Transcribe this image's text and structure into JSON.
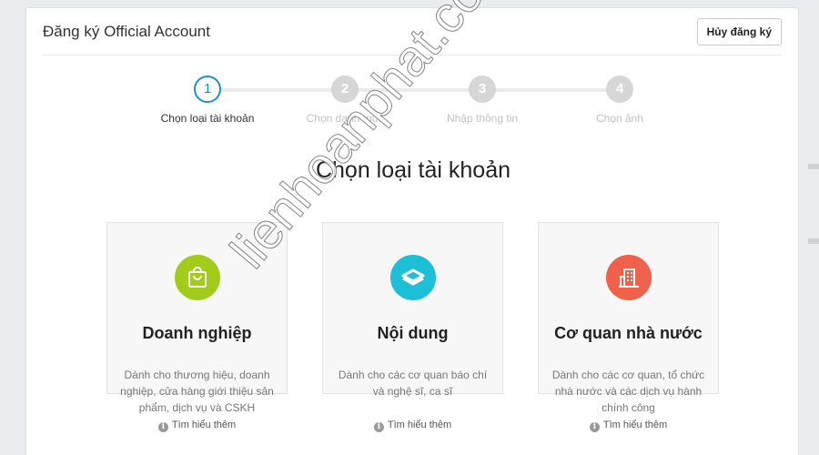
{
  "header": {
    "title": "Đăng ký Official Account",
    "cancel_label": "Hủy đăng ký"
  },
  "stepper": {
    "steps": [
      {
        "number": "1",
        "label": "Chọn loại tài khoản",
        "active": true
      },
      {
        "number": "2",
        "label": "Chọn danh mục",
        "active": false
      },
      {
        "number": "3",
        "label": "Nhập thông tin",
        "active": false
      },
      {
        "number": "4",
        "label": "Chọn ảnh",
        "active": false
      }
    ]
  },
  "main": {
    "title": "Chọn loại tài khoản",
    "cards": [
      {
        "icon": "shopping-bag-icon",
        "color": "#a3cb19",
        "title": "Doanh nghiệp",
        "desc": "Dành cho thương hiệu, doanh nghiệp, cửa hàng giới thiệu sản phẩm, dịch vụ và CSKH",
        "learn_more": "Tìm hiểu thêm"
      },
      {
        "icon": "content-icon",
        "color": "#1cbfd6",
        "title": "Nội dung",
        "desc": "Dành cho các cơ quan báo chí và nghệ sĩ, ca sĩ",
        "learn_more": "Tìm hiểu thêm"
      },
      {
        "icon": "building-icon",
        "color": "#f0614b",
        "title": "Cơ quan nhà nước",
        "desc": "Dành cho các cơ quan, tổ chức nhà nước và các dịch vụ hành chính công",
        "learn_more": "Tìm hiểu thêm"
      }
    ]
  },
  "watermark": "lienhoanphat.com",
  "colors": {
    "accent": "#1e90c9",
    "inactive_step": "#d6d6d6"
  }
}
